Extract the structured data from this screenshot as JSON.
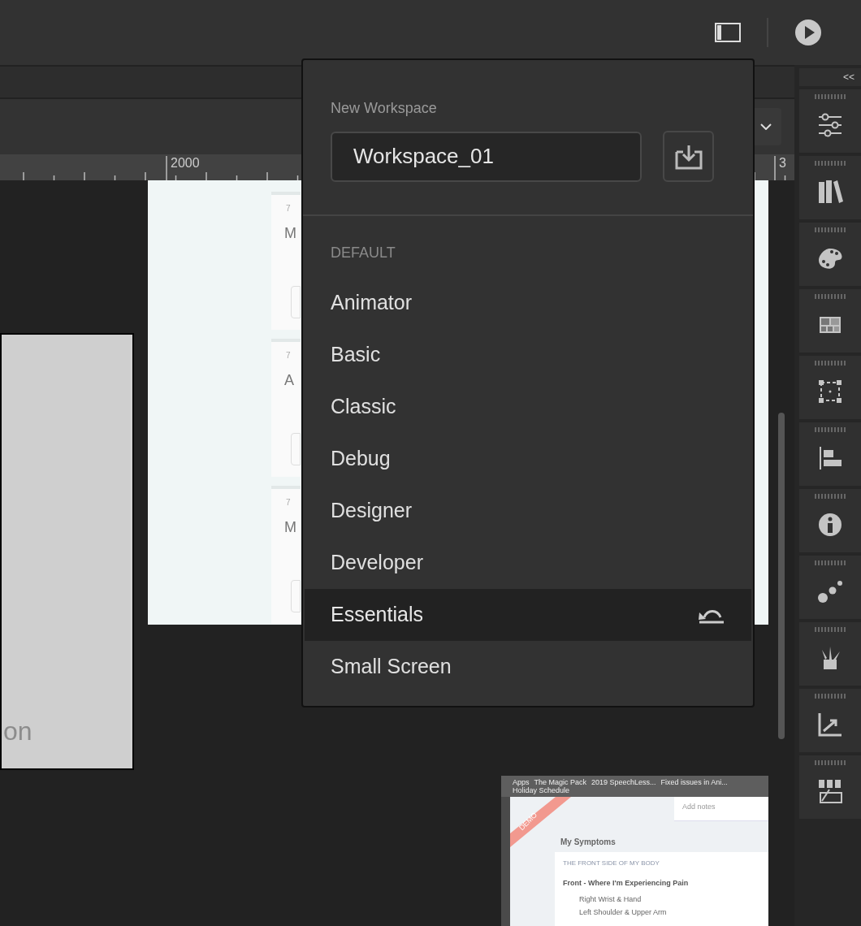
{
  "ruler": {
    "labels": [
      "2000",
      "3"
    ]
  },
  "stage": {
    "cards": [
      {
        "number": "7",
        "letter": "M"
      },
      {
        "number": "7",
        "letter": "A"
      },
      {
        "number": "7",
        "letter": "M"
      }
    ],
    "side_box_text": "on"
  },
  "preview": {
    "bookmarks": [
      "Apps",
      "The Magic Pack",
      "2019 SpeechLess...",
      "Fixed issues in Ani...",
      "Holiday Schedule"
    ],
    "notes_placeholder": "Add notes",
    "ribbon": "DEMO",
    "heading": "My Symptoms",
    "section": "THE FRONT SIDE OF MY BODY",
    "subheading": "Front - Where I'm Experiencing Pain",
    "items": [
      "Right Wrist & Hand",
      "Left Shoulder & Upper Arm"
    ]
  },
  "workspace_menu": {
    "label": "New Workspace",
    "value": "Workspace_01",
    "group": "DEFAULT",
    "items": [
      {
        "label": "Animator",
        "selected": false,
        "modified": false
      },
      {
        "label": "Basic",
        "selected": false,
        "modified": false
      },
      {
        "label": "Classic",
        "selected": false,
        "modified": false
      },
      {
        "label": "Debug",
        "selected": false,
        "modified": false
      },
      {
        "label": "Designer",
        "selected": false,
        "modified": false
      },
      {
        "label": "Developer",
        "selected": false,
        "modified": false
      },
      {
        "label": "Essentials",
        "selected": true,
        "modified": true
      },
      {
        "label": "Small Screen",
        "selected": false,
        "modified": false
      }
    ]
  },
  "panel_dock": {
    "collapse": "<<"
  }
}
